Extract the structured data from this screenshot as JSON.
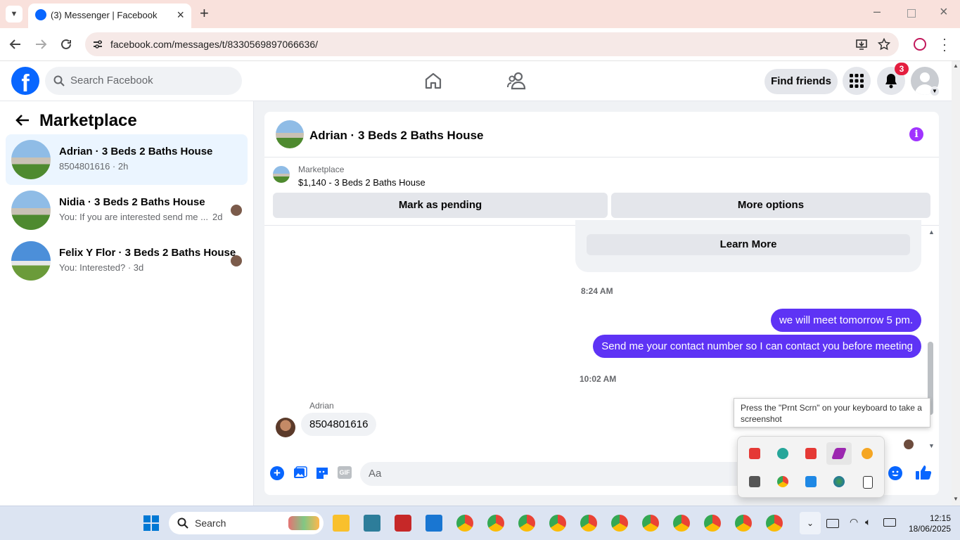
{
  "browser": {
    "tab_title": "(3) Messenger | Facebook",
    "url": "facebook.com/messages/t/8330569897066636/"
  },
  "header": {
    "search_placeholder": "Search Facebook",
    "find_friends": "Find friends",
    "notification_count": "3"
  },
  "sidebar": {
    "title": "Marketplace",
    "conversations": [
      {
        "name": "Adrian · 3 Beds 2 Baths House",
        "snippet": "8504801616 · 2h",
        "selected": true
      },
      {
        "name": "Nidia · 3 Beds 2 Baths House",
        "snippet": "You: If you are interested send me ...",
        "time": "2d"
      },
      {
        "name": "Felix Y Flor · 3 Beds 2 Baths House",
        "snippet": "You: Interested? · 3d"
      }
    ]
  },
  "chat": {
    "title": "Adrian · 3 Beds 2 Baths House",
    "listing_label": "Marketplace",
    "listing_price": "$1,140 - 3 Beds 2 Baths House",
    "mark_pending": "Mark as pending",
    "more_options": "More options",
    "learn_more": "Learn More",
    "messages": [
      {
        "type": "timestamp",
        "text": "8:24 AM"
      },
      {
        "type": "out",
        "text": "we will meet tomorrow 5 pm."
      },
      {
        "type": "out",
        "text": "Send me your contact number so I can contact you before meeting"
      },
      {
        "type": "timestamp",
        "text": "10:02 AM"
      },
      {
        "type": "in",
        "sender": "Adrian",
        "text": "8504801616"
      }
    ],
    "input_placeholder": "Aa"
  },
  "tooltip": "Press the \"Prnt Scrn\" on your keyboard to take a screenshot",
  "taskbar": {
    "search_placeholder": "Search",
    "time": "12:15",
    "date": "18/06/2025"
  },
  "colors": {
    "fb_blue": "#0866ff",
    "outgoing_bubble": "#5e33f5",
    "selected_conv": "#ebf5ff",
    "tab_strip": "#f9e1dc",
    "notification_badge": "#e41e3f"
  }
}
